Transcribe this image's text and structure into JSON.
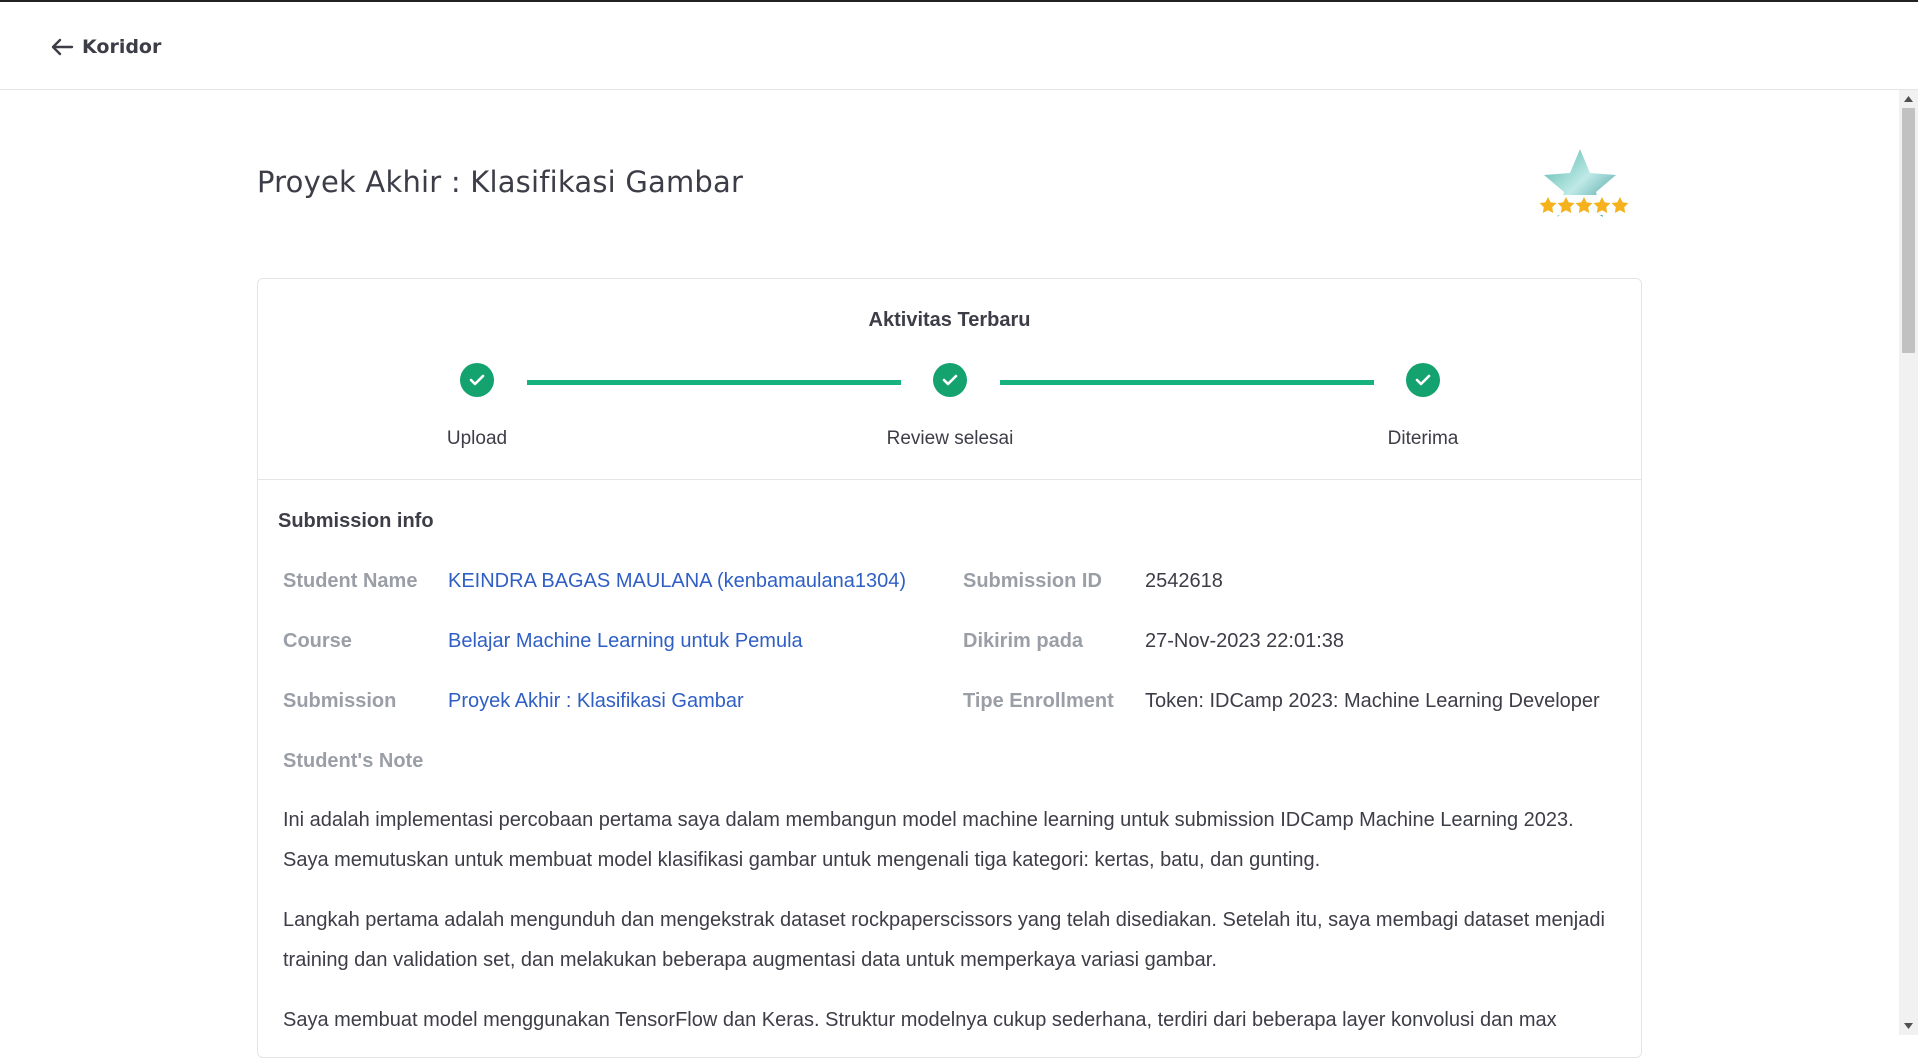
{
  "header": {
    "back_label": "Koridor"
  },
  "page": {
    "title": "Proyek Akhir : Klasifikasi Gambar"
  },
  "activity": {
    "title": "Aktivitas Terbaru",
    "steps": [
      {
        "label": "Upload",
        "status": "done"
      },
      {
        "label": "Review selesai",
        "status": "done"
      },
      {
        "label": "Diterima",
        "status": "done"
      }
    ]
  },
  "submission": {
    "section_title": "Submission info",
    "student_name_label": "Student Name",
    "student_name": "KEINDRA BAGAS MAULANA (kenbamaulana1304)",
    "course_label": "Course",
    "course": "Belajar Machine Learning untuk Pemula",
    "submission_label": "Submission",
    "submission": "Proyek Akhir : Klasifikasi Gambar",
    "submission_id_label": "Submission ID",
    "submission_id": "2542618",
    "sent_label": "Dikirim pada",
    "sent": "27-Nov-2023 22:01:38",
    "enrollment_label": "Tipe Enrollment",
    "enrollment": "Token: IDCamp 2023: Machine Learning Developer",
    "note_label": "Student's Note",
    "note_paragraphs": [
      "Ini adalah implementasi percobaan pertama saya dalam membangun model machine learning untuk submission IDCamp Machine Learning 2023. Saya memutuskan untuk membuat model klasifikasi gambar untuk mengenali tiga kategori: kertas, batu, dan gunting.",
      "Langkah pertama adalah mengunduh dan mengekstrak dataset rockpaperscissors yang telah disediakan. Setelah itu, saya membagi dataset menjadi training dan validation set, dan melakukan beberapa augmentasi data untuk memperkaya variasi gambar.",
      "Saya membuat model menggunakan TensorFlow dan Keras. Struktur modelnya cukup sederhana, terdiri dari beberapa layer konvolusi dan max"
    ]
  },
  "colors": {
    "accent_green": "#14a36f",
    "link_blue": "#2f5fc4",
    "label_gray": "#9a9ea6",
    "text_dark": "#3d3d47"
  },
  "icons": {
    "back": "arrow-left-icon",
    "step": "check-circle-icon",
    "badge": "star-rating-badge-icon"
  },
  "rating": {
    "stars": 5,
    "max": 5
  }
}
